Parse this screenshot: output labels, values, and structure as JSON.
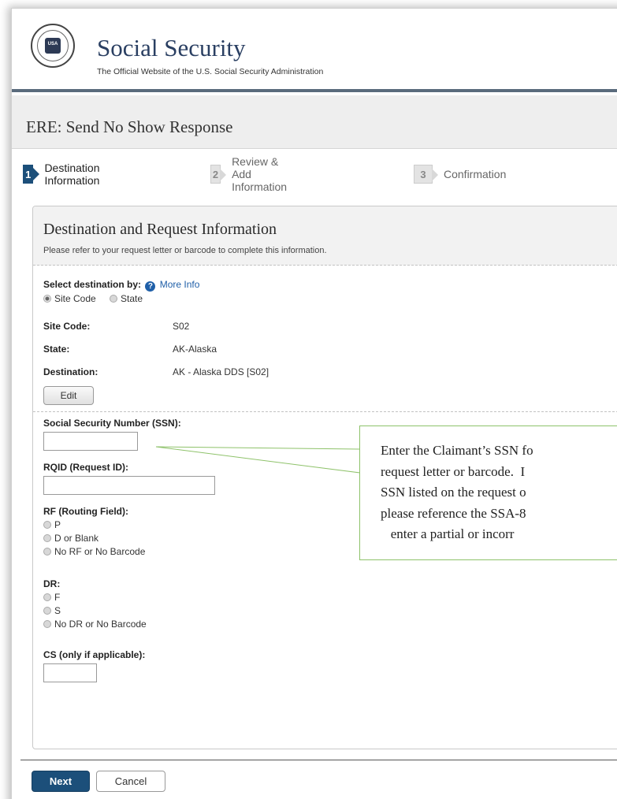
{
  "header": {
    "seal_text": "USA",
    "title": "Social Security",
    "subtitle": "The Official Website of the U.S. Social Security Administration"
  },
  "page": {
    "title": "ERE: Send No Show Response"
  },
  "steps": [
    {
      "num": "1",
      "label": "Destination Information",
      "active": true
    },
    {
      "num": "2",
      "label": "Review & Add Information",
      "active": false
    },
    {
      "num": "3",
      "label": "Confirmation",
      "active": false
    }
  ],
  "panel": {
    "title": "Destination and Request Information",
    "subtitle": "Please refer to your request letter or barcode to complete this information."
  },
  "destination_select": {
    "label": "Select destination by:",
    "help_icon": "?",
    "more_info": "More Info",
    "options": [
      "Site Code",
      "State"
    ],
    "selected": "Site Code"
  },
  "fields": {
    "site_code_label": "Site Code:",
    "site_code_value": "S02",
    "state_label": "State:",
    "state_value": "AK-Alaska",
    "destination_label": "Destination:",
    "destination_value": "AK - Alaska DDS [S02]",
    "edit_label": "Edit",
    "ssn_label": "Social Security Number (SSN):",
    "ssn_value": "",
    "rqid_label": "RQID (Request ID):",
    "rqid_value": "",
    "rf_label": "RF (Routing Field):",
    "rf_options": [
      "P",
      "D or Blank",
      "No RF or No Barcode"
    ],
    "dr_label": "DR:",
    "dr_options": [
      "F",
      "S",
      "No DR or No Barcode"
    ],
    "cs_label": "CS (only if applicable):",
    "cs_value": ""
  },
  "callout": {
    "lines": [
      "Enter the Claimant’s SSN fo",
      "request letter or barcode.  I",
      "SSN listed on the request o",
      "please reference the SSA-8",
      "   enter a partial or incorr"
    ]
  },
  "actions": {
    "next": "Next",
    "cancel": "Cancel"
  },
  "colors": {
    "primary": "#1c4f7a",
    "link": "#1f5fa8",
    "callout_border": "#8ec26a"
  }
}
